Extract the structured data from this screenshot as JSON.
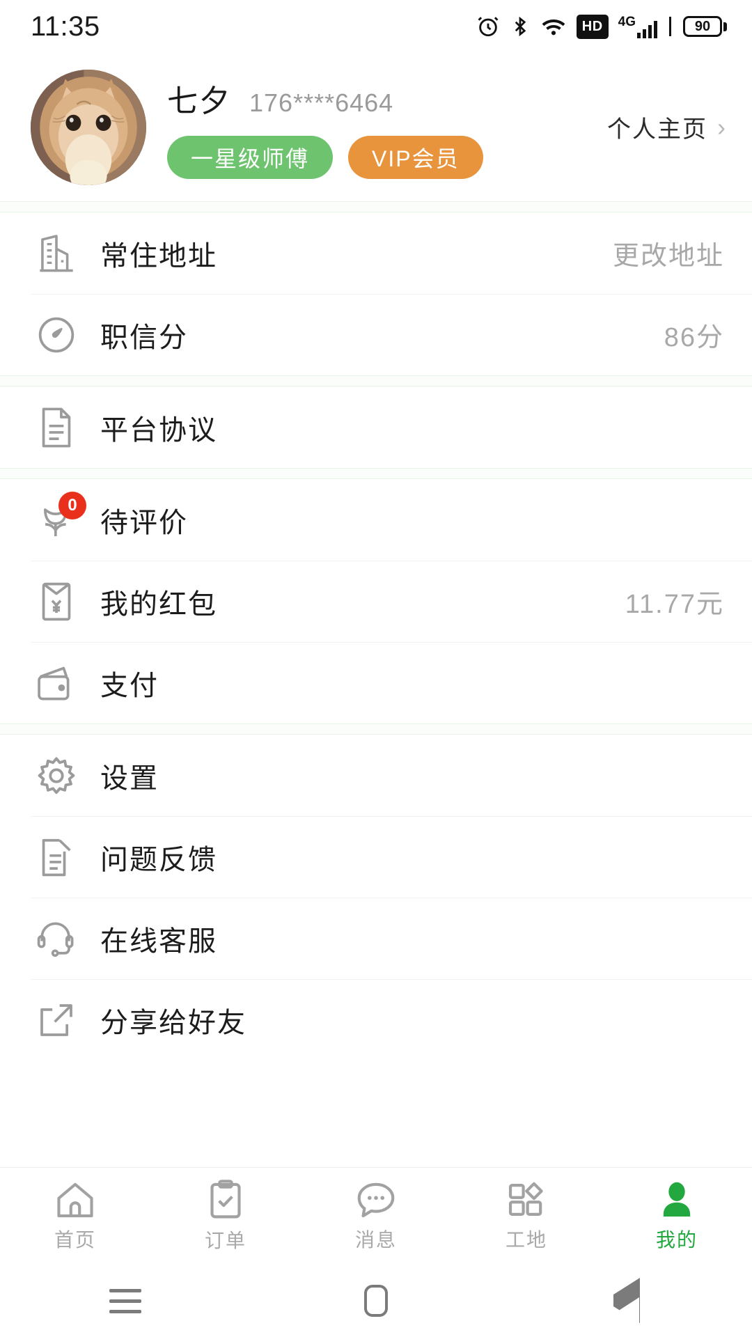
{
  "status_bar": {
    "time": "11:35",
    "battery_level": "90",
    "network_label": "4G",
    "hd_label": "HD",
    "icons": [
      "alarm-icon",
      "bluetooth-icon",
      "wifi-icon",
      "hd-icon",
      "signal-4g-icon",
      "battery-icon"
    ]
  },
  "profile": {
    "avatar_alt": "cat-avatar",
    "name": "七夕",
    "phone": "176****6464",
    "badges": [
      {
        "label": "一星级师傅",
        "color": "#6ec46e"
      },
      {
        "label": "VIP会员",
        "color": "#e8943c"
      }
    ],
    "home_link": "个人主页",
    "chevron": "›"
  },
  "groups": [
    {
      "rows": [
        {
          "icon": "building-icon",
          "label": "常住地址",
          "value": "更改地址"
        },
        {
          "icon": "gauge-icon",
          "label": "职信分",
          "value": "86分"
        }
      ]
    },
    {
      "rows": [
        {
          "icon": "document-icon",
          "label": "平台协议",
          "value": ""
        }
      ]
    },
    {
      "rows": [
        {
          "icon": "flower-icon",
          "label": "待评价",
          "value": "",
          "badge": "0"
        },
        {
          "icon": "red-envelope-icon",
          "label": "我的红包",
          "value": "11.77元"
        },
        {
          "icon": "wallet-icon",
          "label": "支付",
          "value": ""
        }
      ]
    },
    {
      "rows": [
        {
          "icon": "gear-icon",
          "label": "设置",
          "value": ""
        },
        {
          "icon": "edit-note-icon",
          "label": "问题反馈",
          "value": ""
        },
        {
          "icon": "headset-icon",
          "label": "在线客服",
          "value": ""
        },
        {
          "icon": "share-icon",
          "label": "分享给好友",
          "value": ""
        }
      ]
    }
  ],
  "tabbar": {
    "active_color": "#22a83f",
    "inactive_color": "#a9a9a9",
    "tabs": [
      {
        "icon": "home-icon",
        "label": "首页",
        "active": false
      },
      {
        "icon": "clipboard-check-icon",
        "label": "订单",
        "active": false
      },
      {
        "icon": "chat-bubble-icon",
        "label": "消息",
        "active": false
      },
      {
        "icon": "grid-shapes-icon",
        "label": "工地",
        "active": false
      },
      {
        "icon": "person-icon",
        "label": "我的",
        "active": true
      }
    ]
  },
  "android_nav": {
    "recent": "recents-icon",
    "home": "home-square-icon",
    "back": "back-triangle-icon"
  }
}
